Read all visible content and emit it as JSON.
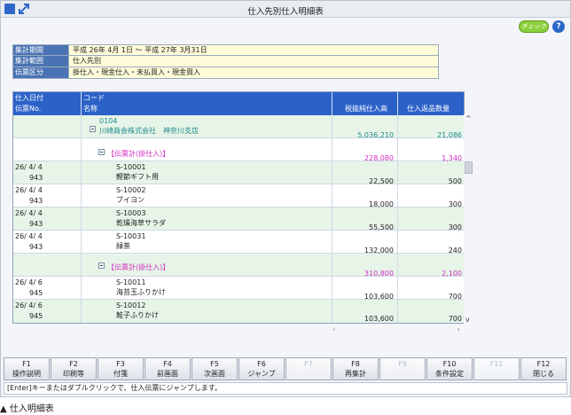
{
  "window": {
    "title": "仕入先別仕入明細表"
  },
  "badge": {
    "label": "チェック"
  },
  "info": [
    {
      "label": "集計期間",
      "value": "平成 26年 4月 1日 〜 平成 27年 3月31日"
    },
    {
      "label": "集計範囲",
      "value": "仕入先別"
    },
    {
      "label": "伝票区分",
      "value": "掛仕入・現金仕入・未払買入・現金買入"
    }
  ],
  "table": {
    "headers": {
      "col1_line1": "仕入日付",
      "col1_line2": "伝票No.",
      "col2_line1": "コード",
      "col2_line2": "名称",
      "col3": "税抜純仕入高",
      "col4": "仕入返品数量"
    },
    "supplier": {
      "code": "0104",
      "name": "川崎商会株式会社　神奈川支店",
      "amount": "5,036,210",
      "qty": "21,086"
    },
    "groups": [
      {
        "label": "【伝票計(掛仕入)】",
        "amount": "228,080",
        "qty": "1,340",
        "rows": [
          {
            "date": "26/ 4/ 4",
            "no": "943",
            "code": "S-10001",
            "name": "鰹節ギフト用",
            "amount": "22,500",
            "qty": "500"
          },
          {
            "date": "26/ 4/ 4",
            "no": "943",
            "code": "S-10002",
            "name": "ブイヨン",
            "amount": "18,000",
            "qty": "300"
          },
          {
            "date": "26/ 4/ 4",
            "no": "943",
            "code": "S-10003",
            "name": "乾燥海草サラダ",
            "amount": "55,500",
            "qty": "300"
          },
          {
            "date": "26/ 4/ 4",
            "no": "943",
            "code": "S-10031",
            "name": "緑茶",
            "amount": "132,000",
            "qty": "240"
          }
        ]
      },
      {
        "label": "【伝票計(掛仕入)】",
        "amount": "310,800",
        "qty": "2,100",
        "rows": [
          {
            "date": "26/ 4/ 6",
            "no": "945",
            "code": "S-10011",
            "name": "海苔玉ふりかけ",
            "amount": "103,600",
            "qty": "700"
          },
          {
            "date": "26/ 4/ 6",
            "no": "945",
            "code": "S-10012",
            "name": "鮭子ふりかけ",
            "amount": "103,600",
            "qty": "700"
          }
        ]
      }
    ]
  },
  "fkeys": [
    {
      "key": "F1",
      "label": "操作説明"
    },
    {
      "key": "F2",
      "label": "印刷等"
    },
    {
      "key": "F3",
      "label": "付箋"
    },
    {
      "key": "F4",
      "label": "前画面"
    },
    {
      "key": "F5",
      "label": "次画面"
    },
    {
      "key": "F6",
      "label": "ジャンプ"
    },
    {
      "key": "F7",
      "label": ""
    },
    {
      "key": "F8",
      "label": "再集計"
    },
    {
      "key": "F9",
      "label": ""
    },
    {
      "key": "F10",
      "label": "条件設定"
    },
    {
      "key": "F11",
      "label": ""
    },
    {
      "key": "F12",
      "label": "閉じる"
    }
  ],
  "status": "[Enter]キーまたはダブルクリックで、仕入伝票にジャンプします。",
  "caption": "▲ 仕入明細表",
  "colors": {
    "header_blue": "#2c62c8",
    "group_green": "#e7f4e8",
    "subtotal_pink": "#d42fc3",
    "supplier_teal": "#1d8a8c"
  }
}
